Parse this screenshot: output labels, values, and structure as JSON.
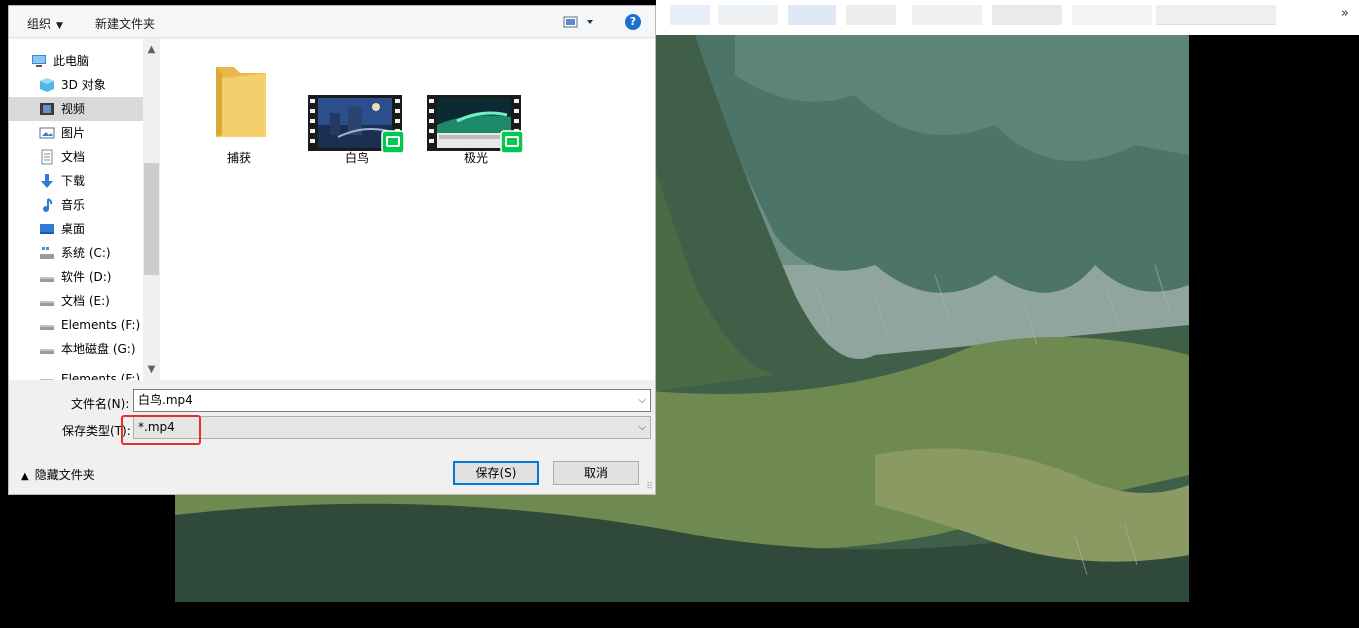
{
  "toolbar": {
    "organize_label": "组织",
    "new_folder_label": "新建文件夹",
    "help_label": "?"
  },
  "sidebar": {
    "items": [
      {
        "label": "此电脑",
        "icon": "pc-icon"
      },
      {
        "label": "3D 对象",
        "icon": "3d-objects-icon"
      },
      {
        "label": "视频",
        "icon": "videos-icon",
        "selected": true
      },
      {
        "label": "图片",
        "icon": "pictures-icon"
      },
      {
        "label": "文档",
        "icon": "documents-icon"
      },
      {
        "label": "下载",
        "icon": "downloads-icon"
      },
      {
        "label": "音乐",
        "icon": "music-icon"
      },
      {
        "label": "桌面",
        "icon": "desktop-icon"
      },
      {
        "label": "系统 (C:)",
        "icon": "system-drive-icon"
      },
      {
        "label": "软件 (D:)",
        "icon": "drive-icon"
      },
      {
        "label": "文档 (E:)",
        "icon": "drive-icon"
      },
      {
        "label": "Elements (F:)",
        "icon": "drive-icon"
      },
      {
        "label": "本地磁盘 (G:)",
        "icon": "drive-icon"
      },
      {
        "label": "Elements (F:)",
        "icon": "drive-icon"
      }
    ]
  },
  "files": [
    {
      "name": "捕获",
      "type": "folder",
      "icon": "folder-icon"
    },
    {
      "name": "白鸟",
      "type": "video",
      "icon": "iqiyi-video-icon"
    },
    {
      "name": "极光",
      "type": "video",
      "icon": "iqiyi-video-icon"
    }
  ],
  "form": {
    "filename_label": "文件名(N):",
    "filename_value": "白鸟.mp4",
    "filetype_label": "保存类型(T):",
    "filetype_value": "*.mp4"
  },
  "footer": {
    "hide_folders_label": "隐藏文件夹",
    "save_label": "保存(S)",
    "cancel_label": "取消"
  },
  "colors": {
    "accent": "#0078d7",
    "highlight_box": "#e5312b",
    "selected_nav": "#d9d9d9"
  }
}
